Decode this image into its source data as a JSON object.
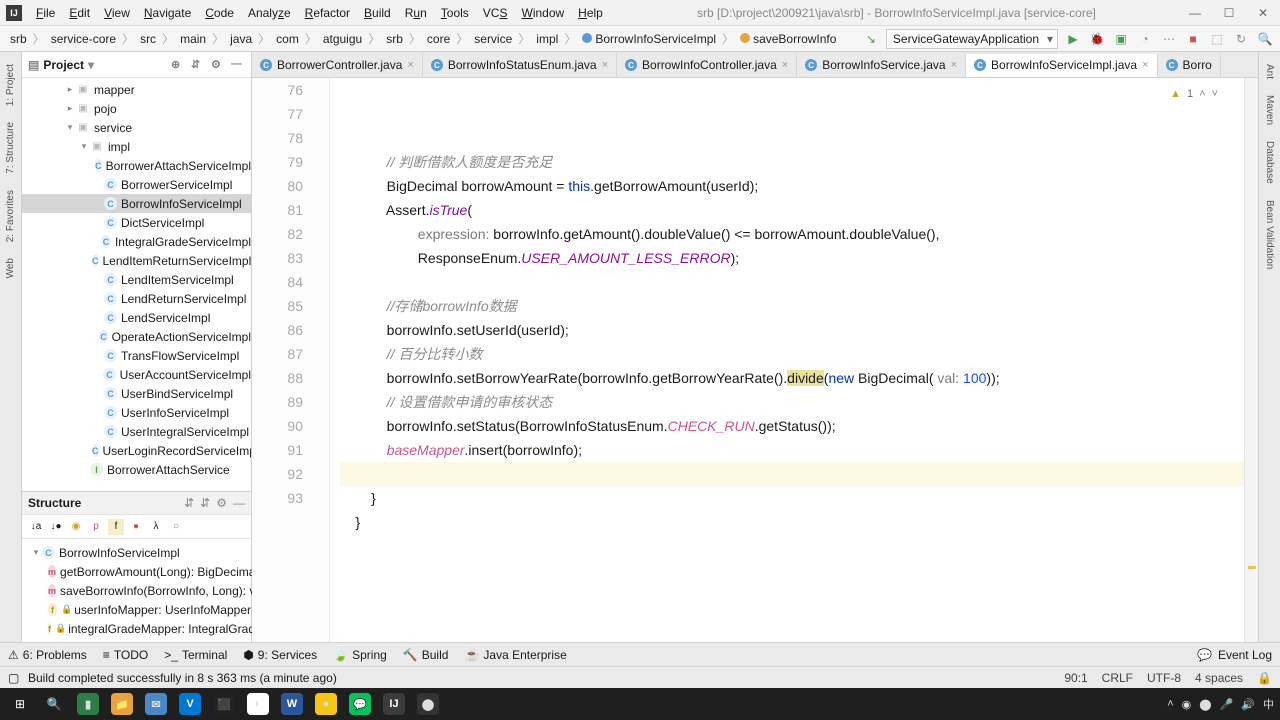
{
  "title_path": "srb [D:\\project\\200921\\java\\srb] - BorrowInfoServiceImpl.java [service-core]",
  "menu": [
    "File",
    "Edit",
    "View",
    "Navigate",
    "Code",
    "Analyze",
    "Refactor",
    "Build",
    "Run",
    "Tools",
    "VCS",
    "Window",
    "Help"
  ],
  "breadcrumb": [
    "srb",
    "service-core",
    "src",
    "main",
    "java",
    "com",
    "atguigu",
    "srb",
    "core",
    "service",
    "impl"
  ],
  "breadcrumb_class": "BorrowInfoServiceImpl",
  "breadcrumb_method": "saveBorrowInfo",
  "run_config": "ServiceGatewayApplication",
  "project": {
    "header": "Project",
    "tree": [
      {
        "indent": 3,
        "arrow": ">",
        "icon": "pkg",
        "label": "mapper"
      },
      {
        "indent": 3,
        "arrow": ">",
        "icon": "pkg",
        "label": "pojo"
      },
      {
        "indent": 3,
        "arrow": "v",
        "icon": "pkg",
        "label": "service"
      },
      {
        "indent": 4,
        "arrow": "v",
        "icon": "pkg",
        "label": "impl"
      },
      {
        "indent": 5,
        "arrow": "",
        "icon": "cls",
        "label": "BorrowerAttachServiceImpl"
      },
      {
        "indent": 5,
        "arrow": "",
        "icon": "cls",
        "label": "BorrowerServiceImpl"
      },
      {
        "indent": 5,
        "arrow": "",
        "icon": "cls",
        "label": "BorrowInfoServiceImpl",
        "selected": true
      },
      {
        "indent": 5,
        "arrow": "",
        "icon": "cls",
        "label": "DictServiceImpl"
      },
      {
        "indent": 5,
        "arrow": "",
        "icon": "cls",
        "label": "IntegralGradeServiceImpl"
      },
      {
        "indent": 5,
        "arrow": "",
        "icon": "cls",
        "label": "LendItemReturnServiceImpl"
      },
      {
        "indent": 5,
        "arrow": "",
        "icon": "cls",
        "label": "LendItemServiceImpl"
      },
      {
        "indent": 5,
        "arrow": "",
        "icon": "cls",
        "label": "LendReturnServiceImpl"
      },
      {
        "indent": 5,
        "arrow": "",
        "icon": "cls",
        "label": "LendServiceImpl"
      },
      {
        "indent": 5,
        "arrow": "",
        "icon": "cls",
        "label": "OperateActionServiceImpl"
      },
      {
        "indent": 5,
        "arrow": "",
        "icon": "cls",
        "label": "TransFlowServiceImpl"
      },
      {
        "indent": 5,
        "arrow": "",
        "icon": "cls",
        "label": "UserAccountServiceImpl"
      },
      {
        "indent": 5,
        "arrow": "",
        "icon": "cls",
        "label": "UserBindServiceImpl"
      },
      {
        "indent": 5,
        "arrow": "",
        "icon": "cls",
        "label": "UserInfoServiceImpl"
      },
      {
        "indent": 5,
        "arrow": "",
        "icon": "cls",
        "label": "UserIntegralServiceImpl"
      },
      {
        "indent": 5,
        "arrow": "",
        "icon": "cls",
        "label": "UserLoginRecordServiceImpl"
      },
      {
        "indent": 4,
        "arrow": "",
        "icon": "iface",
        "label": "BorrowerAttachService"
      }
    ]
  },
  "structure": {
    "header": "Structure",
    "root": "BorrowInfoServiceImpl",
    "members": [
      {
        "icon": "m",
        "label": "getBorrowAmount(Long): BigDecimal"
      },
      {
        "icon": "m",
        "label": "saveBorrowInfo(BorrowInfo, Long): void"
      },
      {
        "icon": "f",
        "lock": true,
        "label": "userInfoMapper: UserInfoMapper"
      },
      {
        "icon": "f",
        "lock": true,
        "label": "integralGradeMapper: IntegralGradeMapper"
      }
    ]
  },
  "tabs": [
    {
      "label": "BorrowerController.java"
    },
    {
      "label": "BorrowInfoStatusEnum.java"
    },
    {
      "label": "BorrowInfoController.java"
    },
    {
      "label": "BorrowInfoService.java"
    },
    {
      "label": "BorrowInfoServiceImpl.java",
      "active": true
    },
    {
      "label": "Borro"
    }
  ],
  "warn_count": "1",
  "gutter_start": 76,
  "gutter_end": 93,
  "code": {
    "l76": "// 判断借款人额度是否充足",
    "l77": {
      "pre": "BigDecimal borrowAmount = ",
      "kw": "this",
      "post": ".getBorrowAmount(userId);"
    },
    "l78": {
      "a": "Assert.",
      "b": "isTrue",
      "c": "("
    },
    "l79": {
      "hint": "expression:",
      "rest": " borrowInfo.getAmount().doubleValue() <= borrowAmount.doubleValue(),"
    },
    "l80": {
      "a": "ResponseEnum.",
      "b": "USER_AMOUNT_LESS_ERROR",
      "c": ");"
    },
    "l82": "//存储borrowInfo数据",
    "l83": "borrowInfo.setUserId(userId);",
    "l84": "// 百分比转小数",
    "l85": {
      "a": "borrowInfo.setBorrowYearRate(borrowInfo.getBorrowYearRate().",
      "hl": "divide",
      "b": "(",
      "kw": "new",
      "c": " BigDecimal( ",
      "hint": "val:",
      "num": " 100",
      "d": "));"
    },
    "l86": "// 设置借款申请的审核状态",
    "l87": {
      "a": "borrowInfo.setStatus(BorrowInfoStatusEnum.",
      "b": "CHECK_RUN",
      "c": ".getStatus());"
    },
    "l88": {
      "a": "baseMapper",
      "b": ".insert(borrowInfo);"
    }
  },
  "bottom_tools": [
    {
      "icon": "⚠",
      "label": "6: Problems"
    },
    {
      "icon": "≡",
      "label": "TODO"
    },
    {
      "icon": ">_",
      "label": "Terminal"
    },
    {
      "icon": "⬢",
      "label": "9: Services"
    },
    {
      "icon": "🍃",
      "label": "Spring"
    },
    {
      "icon": "🔨",
      "label": "Build"
    },
    {
      "icon": "☕",
      "label": "Java Enterprise"
    }
  ],
  "event_log": "Event Log",
  "status_msg": "Build completed successfully in 8 s 363 ms (a minute ago)",
  "status_right": [
    "90:1",
    "CRLF",
    "UTF-8",
    "4 spaces"
  ],
  "left_tabs": [
    "1: Project",
    "7: Structure",
    "2: Favorites",
    "Web"
  ],
  "right_tabs": [
    "Ant",
    "Maven",
    "Database",
    "Bean Validation"
  ],
  "taskbar_time": "中"
}
